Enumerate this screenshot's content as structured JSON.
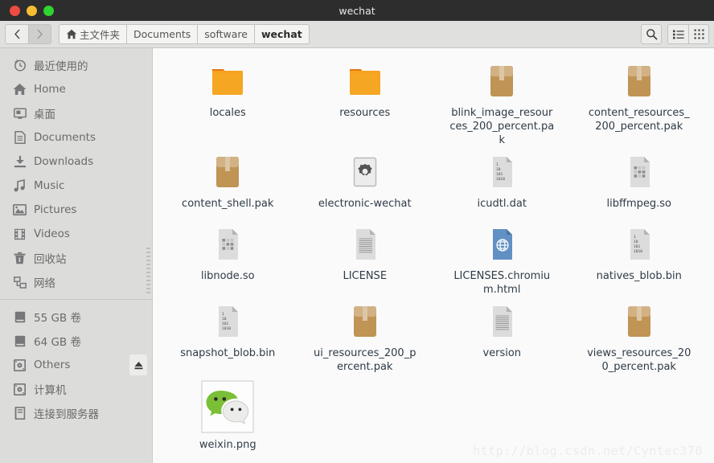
{
  "window": {
    "title": "wechat",
    "controls": [
      {
        "name": "close",
        "color": "#ee4b44"
      },
      {
        "name": "minimize",
        "color": "#f6bd31"
      },
      {
        "name": "maximize",
        "color": "#2fd42f"
      }
    ]
  },
  "toolbar": {
    "back_icon": "chevron-left-icon",
    "forward_icon": "chevron-right-icon",
    "search_icon": "search-icon",
    "list_view_icon": "list-view-icon",
    "grid_view_icon": "grid-view-icon",
    "breadcrumbs": [
      {
        "label": "主文件夹",
        "icon": "home-icon",
        "active": false
      },
      {
        "label": "Documents",
        "icon": "",
        "active": false
      },
      {
        "label": "software",
        "icon": "",
        "active": false
      },
      {
        "label": "wechat",
        "icon": "",
        "active": true
      }
    ]
  },
  "sidebar": {
    "items": [
      {
        "label": "最近使用的",
        "icon": "clock-icon"
      },
      {
        "label": "Home",
        "icon": "home-icon"
      },
      {
        "label": "桌面",
        "icon": "desktop-icon"
      },
      {
        "label": "Documents",
        "icon": "document-icon"
      },
      {
        "label": "Downloads",
        "icon": "download-icon"
      },
      {
        "label": "Music",
        "icon": "music-icon"
      },
      {
        "label": "Pictures",
        "icon": "picture-icon"
      },
      {
        "label": "Videos",
        "icon": "video-icon"
      },
      {
        "label": "回收站",
        "icon": "trash-icon"
      },
      {
        "label": "网络",
        "icon": "network-icon"
      }
    ],
    "devices": [
      {
        "label": "55 GB 卷",
        "icon": "drive-icon",
        "eject": false
      },
      {
        "label": "64 GB 卷",
        "icon": "drive-icon",
        "eject": false
      },
      {
        "label": "Others",
        "icon": "disc-icon",
        "eject": true
      },
      {
        "label": "计算机",
        "icon": "disc-icon",
        "eject": false
      },
      {
        "label": "连接到服务器",
        "icon": "server-icon",
        "eject": false
      }
    ]
  },
  "files": [
    {
      "name": "locales",
      "icon": "folder-icon"
    },
    {
      "name": "resources",
      "icon": "folder-icon"
    },
    {
      "name": "blink_image_resources_200_percent.pak",
      "icon": "package-icon"
    },
    {
      "name": "content_resources_200_percent.pak",
      "icon": "package-icon"
    },
    {
      "name": "content_shell.pak",
      "icon": "package-icon"
    },
    {
      "name": "electronic-wechat",
      "icon": "executable-icon"
    },
    {
      "name": "icudtl.dat",
      "icon": "binary-file-icon"
    },
    {
      "name": "libffmpeg.so",
      "icon": "library-file-icon"
    },
    {
      "name": "libnode.so",
      "icon": "library-file-icon"
    },
    {
      "name": "LICENSE",
      "icon": "text-file-icon"
    },
    {
      "name": "LICENSES.chromium.html",
      "icon": "html-file-icon"
    },
    {
      "name": "natives_blob.bin",
      "icon": "binary-file-icon"
    },
    {
      "name": "snapshot_blob.bin",
      "icon": "binary-file-icon"
    },
    {
      "name": "ui_resources_200_percent.pak",
      "icon": "package-icon"
    },
    {
      "name": "version",
      "icon": "text-file-icon"
    },
    {
      "name": "views_resources_200_percent.pak",
      "icon": "package-icon"
    },
    {
      "name": "weixin.png",
      "icon": "wechat-image-icon"
    }
  ],
  "watermark": "http://blog.csdn.net/Cyntec370",
  "colors": {
    "titlebar": "#2d2d2d",
    "toolbar": "#e0e0de",
    "sidebar": "#dcdcda",
    "file_area": "#fafafa",
    "folder": "#f5a623",
    "package": "#c1924f",
    "html": "#6191c4",
    "wechat_green": "#7bbf37"
  }
}
